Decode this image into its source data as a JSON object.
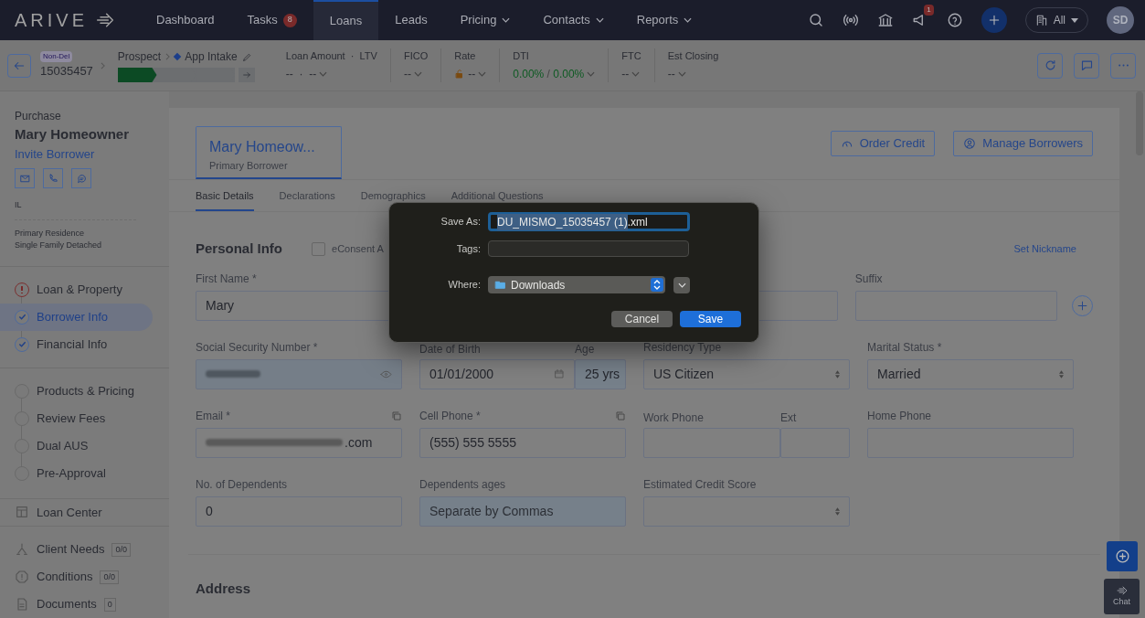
{
  "nav": {
    "logo": "ARIVE",
    "items": [
      {
        "label": "Dashboard",
        "selected": false,
        "dropdown": false
      },
      {
        "label": "Tasks",
        "selected": false,
        "dropdown": false,
        "badge": "8"
      },
      {
        "label": "Loans",
        "selected": true,
        "dropdown": false
      },
      {
        "label": "Leads",
        "selected": false,
        "dropdown": false
      },
      {
        "label": "Pricing",
        "selected": false,
        "dropdown": true
      },
      {
        "label": "Contacts",
        "selected": false,
        "dropdown": true
      },
      {
        "label": "Reports",
        "selected": false,
        "dropdown": true
      }
    ],
    "announcement_badge": "1",
    "scope": "All",
    "avatar": "SD"
  },
  "loan_bar": {
    "channel": "Non-Del",
    "loan_number": "15035457",
    "stage": "Prospect",
    "sub_stage": "App Intake",
    "segments": [
      {
        "done": true
      },
      {
        "done": false
      },
      {
        "done": false
      }
    ],
    "metrics": [
      {
        "label": "Loan Amount  ·  LTV",
        "value": "--  ·  --",
        "kind": "plain"
      },
      {
        "label": "FICO",
        "value": "--",
        "kind": "plain"
      },
      {
        "label": "Rate",
        "value": "--",
        "kind": "rate"
      },
      {
        "label": "DTI",
        "value": "0.00%",
        "separator": "/",
        "value2": "0.00%",
        "kind": "ratio"
      },
      {
        "label": "FTC",
        "value": "--",
        "kind": "plain"
      },
      {
        "label": "Est Closing",
        "value": "--",
        "kind": "plain"
      }
    ]
  },
  "sidebar": {
    "purpose": "Purchase",
    "borrower": "Mary Homeowner",
    "invite": "Invite Borrower",
    "state": "IL",
    "occupancy": "Primary Residence",
    "property_type": "Single Family Detached",
    "step_groups": [
      [
        {
          "label": "Loan & Property",
          "kind": "error",
          "selected": false
        },
        {
          "label": "Borrower Info",
          "kind": "done",
          "selected": true
        },
        {
          "label": "Financial Info",
          "kind": "done",
          "selected": false
        }
      ],
      [
        {
          "label": "Products & Pricing",
          "kind": "todo",
          "selected": false
        },
        {
          "label": "Review Fees",
          "kind": "todo",
          "selected": false
        },
        {
          "label": "Dual AUS",
          "kind": "todo",
          "selected": false
        },
        {
          "label": "Pre-Approval",
          "kind": "todo",
          "selected": false
        }
      ]
    ],
    "loan_center": "Loan Center",
    "links": [
      {
        "label": "Client Needs",
        "count": "0/0",
        "kind": "needs"
      },
      {
        "label": "Conditions",
        "count": "0/0",
        "kind": "conditions"
      },
      {
        "label": "Documents",
        "count": "0",
        "kind": "documents"
      }
    ]
  },
  "main": {
    "borrower_tab": {
      "name": "Mary Homeow...",
      "role": "Primary Borrower",
      "selected": true
    },
    "actions": [
      {
        "label": "Order Credit",
        "kind": "credit"
      },
      {
        "label": "Manage Borrowers",
        "kind": "borrowers"
      }
    ],
    "tabs": [
      {
        "label": "Basic Details",
        "selected": true
      },
      {
        "label": "Declarations",
        "selected": false
      },
      {
        "label": "Demographics",
        "selected": false
      },
      {
        "label": "Additional Questions",
        "selected": false
      }
    ],
    "section": "Personal Info",
    "econsent": {
      "label": "eConsent A",
      "checked": false
    },
    "nickname": "Set Nickname",
    "rows": [
      [
        {
          "kind": "text",
          "label": "First Name *",
          "value": "Mary"
        },
        {
          "kind": "text"
        },
        {
          "kind": "text",
          "label": "Suffix"
        }
      ],
      [
        {
          "kind": "masked",
          "label": "Social Security Number *"
        },
        {
          "kind": "date",
          "label": "Date of Birth",
          "value": "01/01/2000",
          "age_label": "Age",
          "age": "25 yrs"
        },
        {
          "kind": "select",
          "label": "Residency Type",
          "value": "US Citizen"
        },
        {
          "kind": "select",
          "label": "Marital Status *",
          "value": "Married"
        }
      ],
      [
        {
          "kind": "email",
          "label": "Email *",
          "value": ".com",
          "copy": true
        },
        {
          "kind": "text",
          "label": "Cell Phone *",
          "value": "(555) 555 5555",
          "copy": true
        },
        {
          "kind": "phone_ext",
          "label": "Work Phone",
          "ext_label": "Ext"
        },
        {
          "kind": "text",
          "label": "Home Phone"
        }
      ],
      [
        {
          "kind": "text",
          "label": "No. of Dependents",
          "value": "0"
        },
        {
          "kind": "tinted",
          "label": "Dependents ages",
          "placeholder": "Separate by Commas"
        },
        {
          "kind": "select",
          "label": "Estimated Credit Score"
        }
      ]
    ],
    "next_section": "Address"
  },
  "dialog": {
    "save_as_label": "Save As:",
    "file_selected": "DU_MISMO_15035457 (1)",
    "file_rest": ".xml",
    "tags_label": "Tags:",
    "where_label": "Where:",
    "where": "Downloads",
    "buttons": [
      {
        "label": "Cancel",
        "primary": false
      },
      {
        "label": "Save",
        "primary": true
      }
    ]
  },
  "chat": "Chat"
}
